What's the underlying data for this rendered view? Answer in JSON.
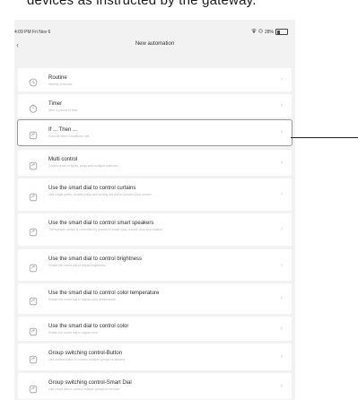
{
  "caption": "devices as instructed by the gateway.",
  "statusbar": {
    "time": "4:09 PM  Fri Nov 6",
    "battery": "28%",
    "battery_level": 0.28
  },
  "header": {
    "title": "New automation"
  },
  "items": [
    {
      "title": "Routine",
      "subtitle": "Weekly schedule",
      "icon": "clock-icon"
    },
    {
      "title": "Timer",
      "subtitle": "After a period of time",
      "icon": "timer-icon"
    },
    {
      "title": "If ... Then ...",
      "subtitle": "Execute when conditions met",
      "icon": "automation-icon"
    },
    {
      "title": "Multi control",
      "subtitle": "Control a set of lights, plugs and multiple switches",
      "icon": "automation-icon"
    },
    {
      "title": "Use the smart dial to control curtains",
      "subtitle": "Use single press, double press and turning the dial to position your curtain",
      "icon": "automation-icon"
    },
    {
      "title": "Use the smart dial to control smart speakers",
      "subtitle": "The speaker action is controlled by means of single click, double click and rotation",
      "icon": "automation-icon"
    },
    {
      "title": "Use the smart dial to control brightness",
      "subtitle": "Rotate the smart dial to adjust brightness",
      "icon": "automation-icon"
    },
    {
      "title": "Use the smart dial to control color temperature",
      "subtitle": "Rotate the smart dial to adjust color temperature",
      "icon": "automation-icon"
    },
    {
      "title": "Use the smart dial to control color",
      "subtitle": "Rotate the smart dial to adjust color",
      "icon": "automation-icon"
    },
    {
      "title": "Group switching control-Button",
      "subtitle": "Use control button to control multiple groups of devices",
      "icon": "automation-icon"
    },
    {
      "title": "Group switching control-Smart Dial",
      "subtitle": "Use smart dial to control multiple groups of devices",
      "icon": "automation-icon"
    }
  ]
}
